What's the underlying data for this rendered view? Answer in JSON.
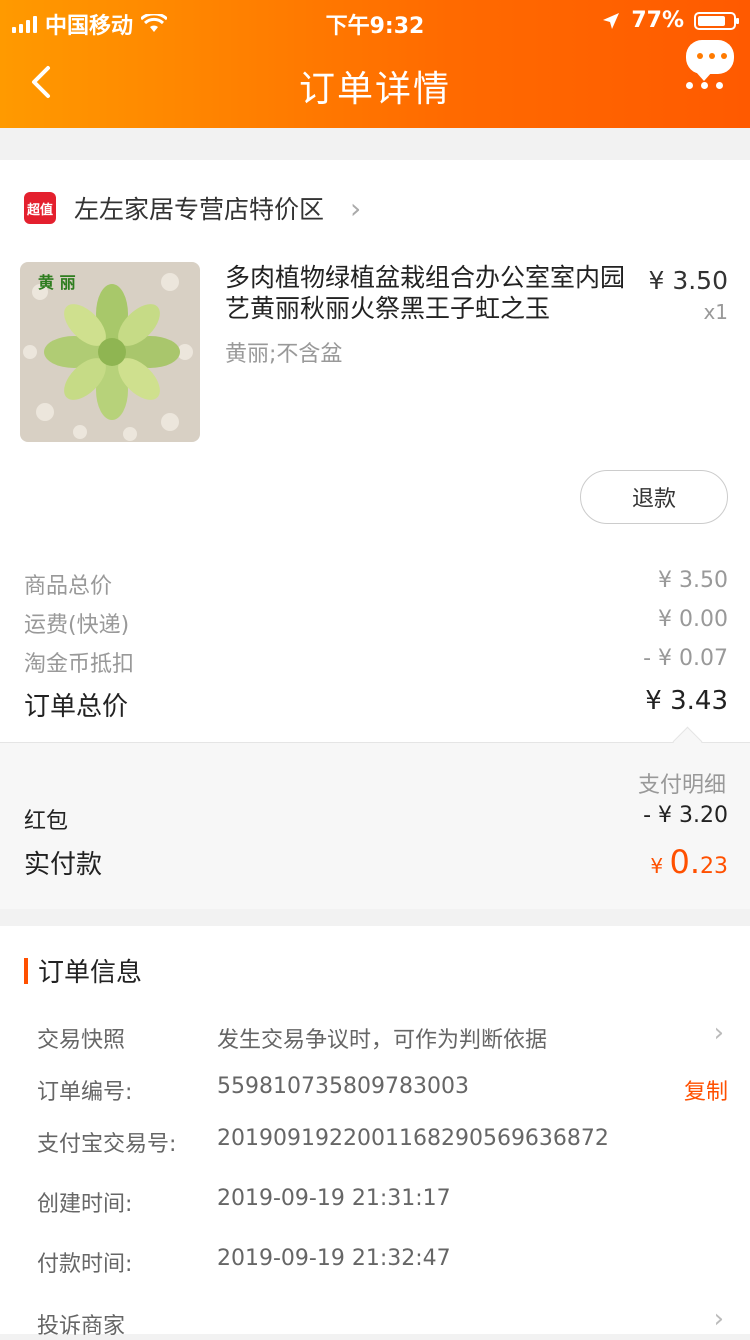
{
  "status_bar": {
    "carrier": "中国移动",
    "time": "下午9:32",
    "battery": "77%"
  },
  "nav": {
    "title": "订单详情"
  },
  "shop": {
    "badge": "超值",
    "name": "左左家居专营店特价区"
  },
  "product": {
    "image_label": "黄 丽",
    "title": "多肉植物绿植盆栽组合办公室室内园艺黄丽秋丽火祭黑王子虹之玉",
    "sku": "黄丽;不含盆",
    "price": "¥ 3.50",
    "qty": "x1",
    "refund_label": "退款"
  },
  "summary": [
    {
      "label": "商品总价",
      "value": "¥ 3.50"
    },
    {
      "label": "运费(快递)",
      "value": "¥ 0.00"
    },
    {
      "label": "淘金币抵扣",
      "value": "- ¥ 0.07"
    }
  ],
  "total": {
    "label": "订单总价",
    "value": "¥ 3.43"
  },
  "payment": {
    "detail_label": "支付明细",
    "redpacket_label": "红包",
    "redpacket_value": "- ¥ 3.20",
    "paid_label": "实付款",
    "paid_currency": "¥ ",
    "paid_int": "0.",
    "paid_dec": "23"
  },
  "order_info": {
    "title": "订单信息",
    "snapshot_label": "交易快照",
    "snapshot_value": "发生交易争议时，可作为判断依据",
    "order_no_label": "订单编号:",
    "order_no": "559810735809783003",
    "copy_label": "复制",
    "alipay_label": "支付宝交易号:",
    "alipay_no": "2019091922001168290569636872",
    "created_label": "创建时间:",
    "created": "2019-09-19 21:31:17",
    "paid_time_label": "付款时间:",
    "paid_time": "2019-09-19 21:32:47",
    "complain_label": "投诉商家"
  }
}
